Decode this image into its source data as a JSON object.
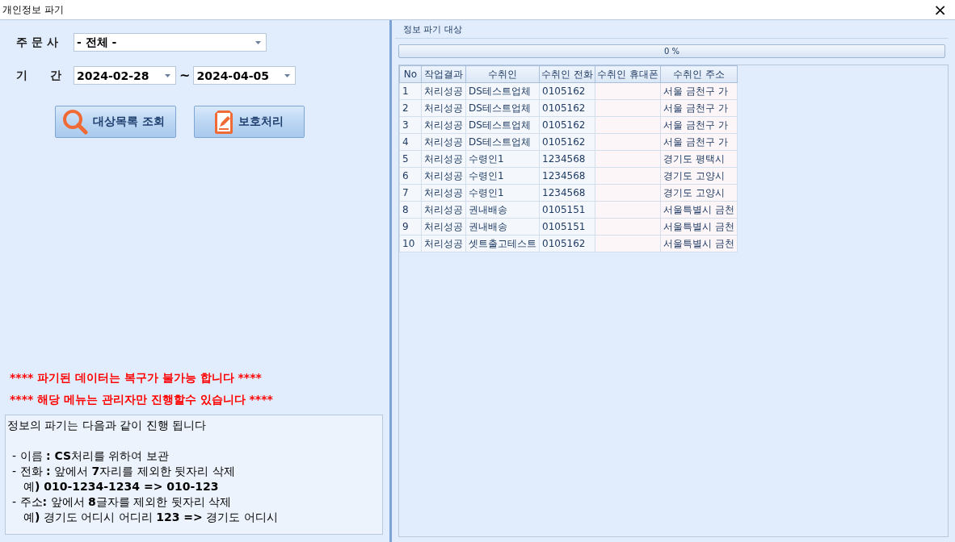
{
  "window": {
    "title": "개인정보 파기",
    "close": "×"
  },
  "filters": {
    "company_label": "주 문 사",
    "company_value": "- 전체 -",
    "period_label": "기　　간",
    "date_from": "2024-02-28",
    "separator": "~",
    "date_to": "2024-04-05"
  },
  "buttons": [
    {
      "label": "대상목록 조회",
      "kind": "search"
    },
    {
      "label": "보호처리",
      "kind": "protect"
    }
  ],
  "warnings": [
    "**** 파기된 데이터는 복구가 불가능 합니다 ****",
    "**** 해당 메뉴는 관리자만 진행할수 있습니다 ****"
  ],
  "notes": [
    {
      "text": "정보의 파기는 다음과 같이 진행 됩니다",
      "kind": "heading"
    },
    {
      "text": "- 이름 **: CS**처리를 위하여 보관",
      "kind": "item"
    },
    {
      "text": "- 전화 **:** 앞에서 **7**자리를 제외한 뒷자리 삭제",
      "kind": "item"
    },
    {
      "text": "예**) 010-1234-1234 => 010-123**",
      "kind": "example"
    },
    {
      "text": "- 주소**:** 앞에서 **8**글자를 제외한 뒷자리 삭제",
      "kind": "item"
    },
    {
      "text": "예**)** 경기도 어디시 어디리 **123 =>** 경기도 어디시",
      "kind": "example"
    }
  ],
  "target_panel": {
    "title": "정보 파기 대상",
    "progress": {
      "level": 0,
      "reading": "0 %"
    }
  },
  "table": {
    "columns": [
      "No",
      "작업결과",
      "수취인",
      "수취인 전화",
      "수취인 휴대폰",
      "수취인 주소"
    ],
    "rows": [
      [
        "1",
        "처리성공",
        "DS테스트업체",
        "0105162",
        "",
        "서울 금천구 가"
      ],
      [
        "2",
        "처리성공",
        "DS테스트업체",
        "0105162",
        "",
        "서울 금천구 가"
      ],
      [
        "3",
        "처리성공",
        "DS테스트업체",
        "0105162",
        "",
        "서울 금천구 가"
      ],
      [
        "4",
        "처리성공",
        "DS테스트업체",
        "0105162",
        "",
        "서울 금천구 가"
      ],
      [
        "5",
        "처리성공",
        "수령인1",
        "1234568",
        "",
        "경기도 평택시"
      ],
      [
        "6",
        "처리성공",
        "수령인1",
        "1234568",
        "",
        "경기도 고양시"
      ],
      [
        "7",
        "처리성공",
        "수령인1",
        "1234568",
        "",
        "경기도 고양시"
      ],
      [
        "8",
        "처리성공",
        "권내배송",
        "0105151",
        "",
        "서울특별시 금천"
      ],
      [
        "9",
        "처리성공",
        "권내배송",
        "0105151",
        "",
        "서울특별시 금천"
      ],
      [
        "10",
        "처리성공",
        "셋트출고테스트",
        "0105162",
        "",
        "서울특별시 금천"
      ]
    ]
  }
}
